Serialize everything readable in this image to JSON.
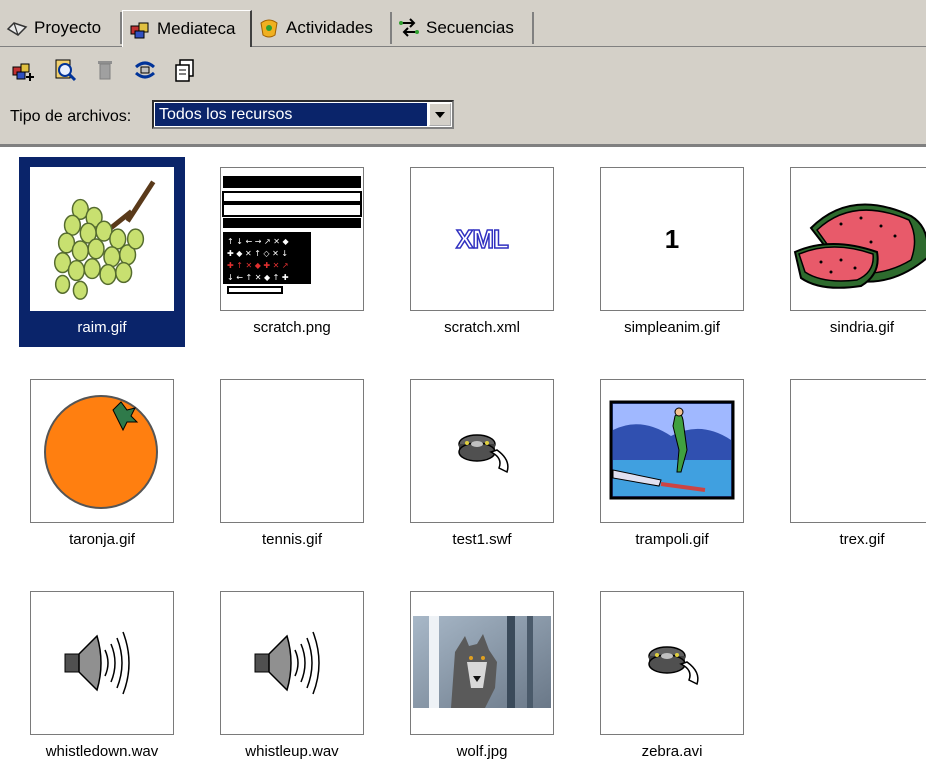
{
  "tabs": [
    {
      "label": "Proyecto",
      "icon": "project-icon"
    },
    {
      "label": "Mediateca",
      "icon": "mediateca-icon",
      "active": true
    },
    {
      "label": "Actividades",
      "icon": "activities-icon"
    },
    {
      "label": "Secuencias",
      "icon": "sequences-icon"
    }
  ],
  "toolbar": {
    "buttons": [
      "add-media-icon",
      "preview-icon",
      "delete-icon",
      "refresh-icon",
      "copy-icon"
    ]
  },
  "filter": {
    "label": "Tipo de archivos:",
    "selected": "Todos los recursos"
  },
  "media": [
    {
      "name": "raim.gif",
      "thumb": "grapes",
      "selected": true
    },
    {
      "name": "scratch.png",
      "thumb": "scratch"
    },
    {
      "name": "scratch.xml",
      "thumb": "xml",
      "thumb_text": "XML"
    },
    {
      "name": "simpleanim.gif",
      "thumb": "number",
      "thumb_text": "1"
    },
    {
      "name": "sindria.gif",
      "thumb": "watermelon"
    },
    {
      "name": "taronja.gif",
      "thumb": "orange"
    },
    {
      "name": "tennis.gif",
      "thumb": "blank"
    },
    {
      "name": "test1.swf",
      "thumb": "film"
    },
    {
      "name": "trampoli.gif",
      "thumb": "diver"
    },
    {
      "name": "trex.gif",
      "thumb": "blank"
    },
    {
      "name": "whistledown.wav",
      "thumb": "speaker"
    },
    {
      "name": "whistleup.wav",
      "thumb": "speaker"
    },
    {
      "name": "wolf.jpg",
      "thumb": "wolf"
    },
    {
      "name": "zebra.avi",
      "thumb": "film"
    }
  ],
  "colors": {
    "selection": "#0a246a",
    "chrome": "#d4d0c8"
  }
}
